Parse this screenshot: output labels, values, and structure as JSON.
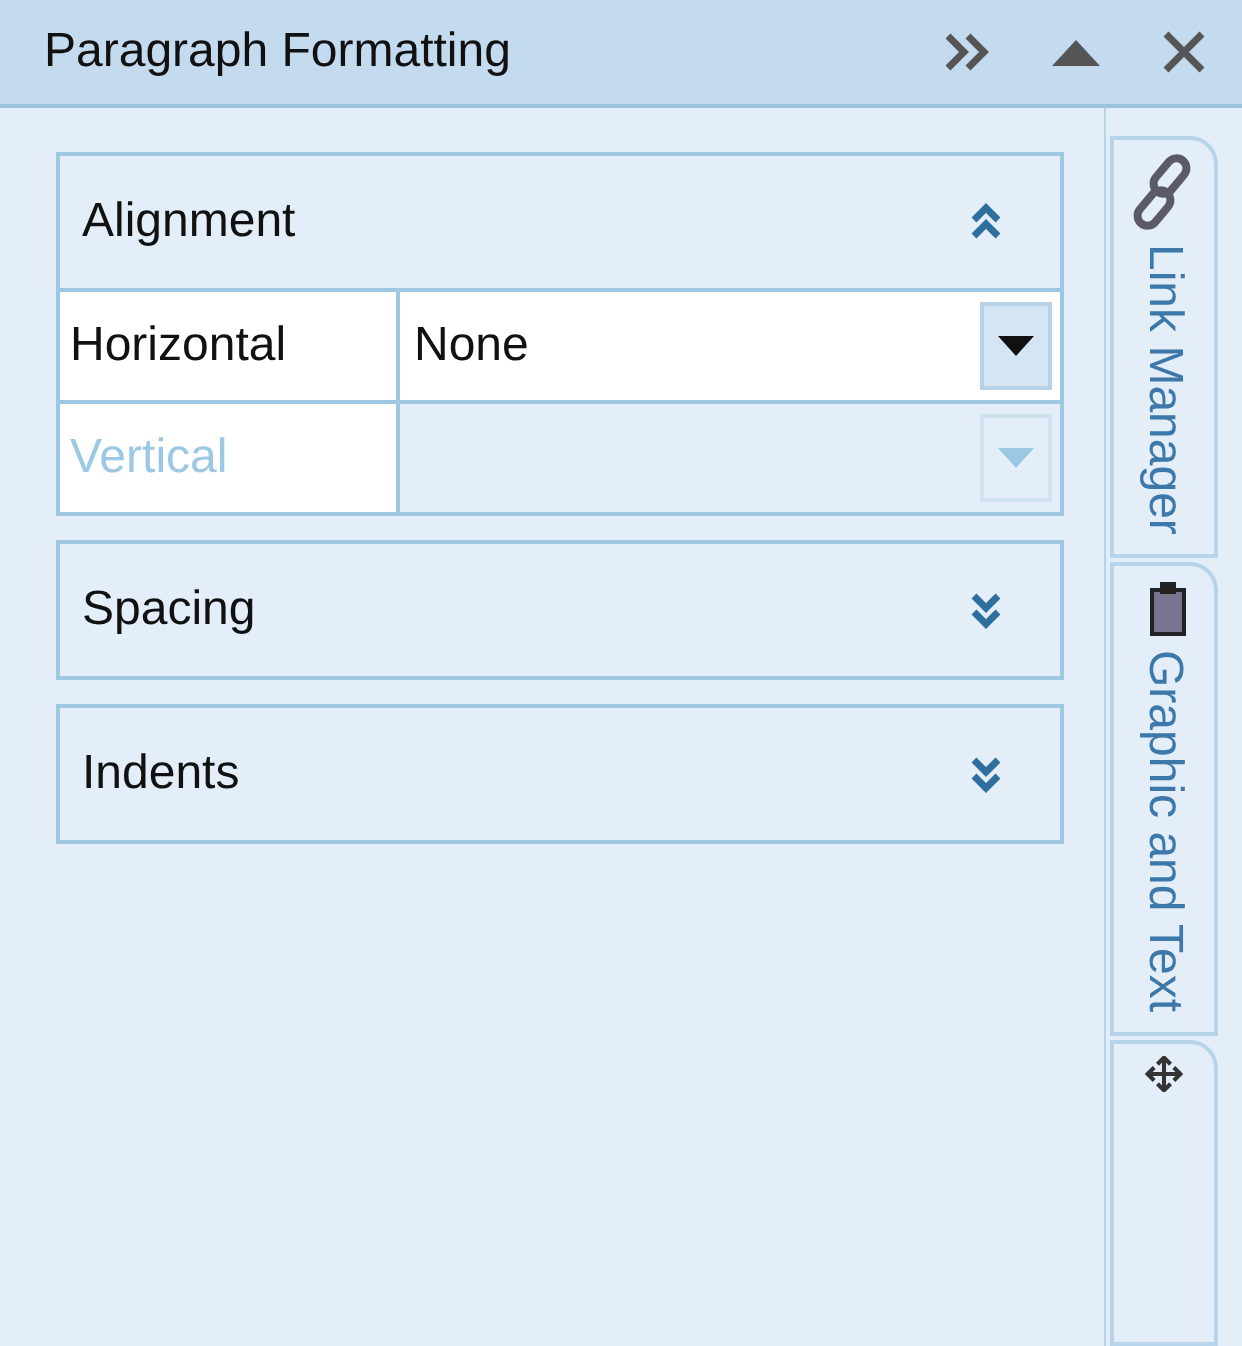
{
  "window": {
    "title": "Paragraph Formatting"
  },
  "sections": [
    {
      "title": "Alignment",
      "expanded": true,
      "rows": [
        {
          "label": "Horizontal",
          "value": "None",
          "disabled": false
        },
        {
          "label": "Vertical",
          "disabled": true
        }
      ]
    },
    {
      "title": "Spacing",
      "expanded": false
    },
    {
      "title": "Indents",
      "expanded": false
    }
  ],
  "side_tabs": [
    {
      "label": "Link Manager",
      "kind": "link"
    },
    {
      "label": "Graphic and Text",
      "kind": "clipboard"
    },
    {
      "kind": "move"
    }
  ]
}
